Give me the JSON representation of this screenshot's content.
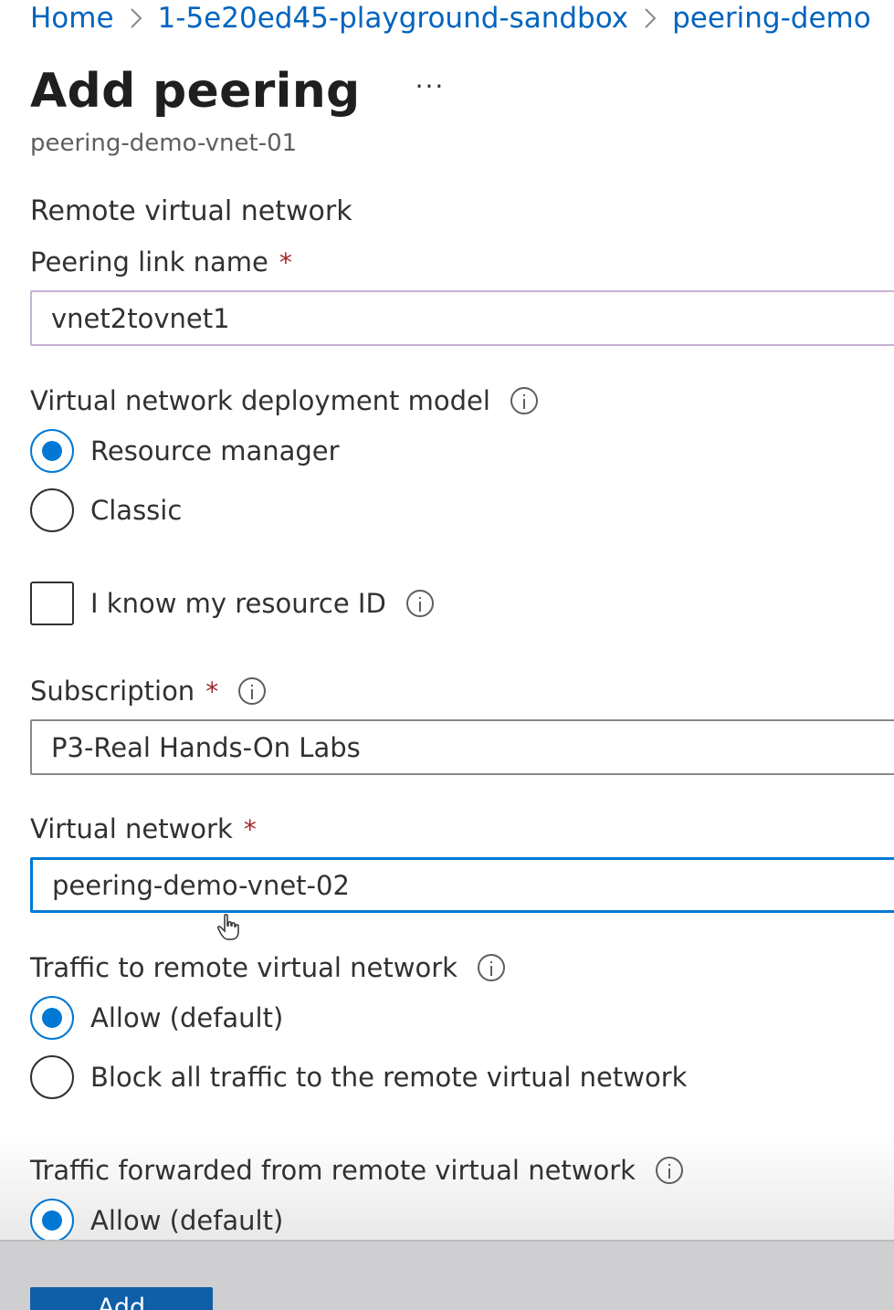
{
  "breadcrumb": [
    "Home",
    "1-5e20ed45-playground-sandbox",
    "peering-demo"
  ],
  "header": {
    "title": "Add peering",
    "more_label": "···",
    "subtitle": "peering-demo-vnet-01"
  },
  "form": {
    "section_title": "Remote virtual network",
    "peering_link_name": {
      "label": "Peering link name",
      "required_mark": "*",
      "value": "vnet2tovnet1"
    },
    "deployment_model": {
      "label": "Virtual network deployment model",
      "options": [
        {
          "label": "Resource manager",
          "selected": true
        },
        {
          "label": "Classic",
          "selected": false
        }
      ]
    },
    "resource_id_checkbox": {
      "label": "I know my resource ID",
      "checked": false
    },
    "subscription": {
      "label": "Subscription",
      "required_mark": "*",
      "value": "P3-Real Hands-On Labs"
    },
    "virtual_network": {
      "label": "Virtual network",
      "required_mark": "*",
      "value": "peering-demo-vnet-02"
    },
    "traffic_to_remote": {
      "label": "Traffic to remote virtual network",
      "options": [
        {
          "label": "Allow (default)",
          "selected": true
        },
        {
          "label": "Block all traffic to the remote virtual network",
          "selected": false
        }
      ]
    },
    "traffic_forwarded": {
      "label": "Traffic forwarded from remote virtual network",
      "options": [
        {
          "label": "Allow (default)",
          "selected": true
        }
      ]
    }
  },
  "footer": {
    "add_label": "Add"
  },
  "colors": {
    "accent": "#0078d4",
    "link": "#0064bf",
    "required": "#a4262c"
  },
  "icons": [
    "chevron-right-icon",
    "info-icon",
    "hand-pointer-icon"
  ]
}
